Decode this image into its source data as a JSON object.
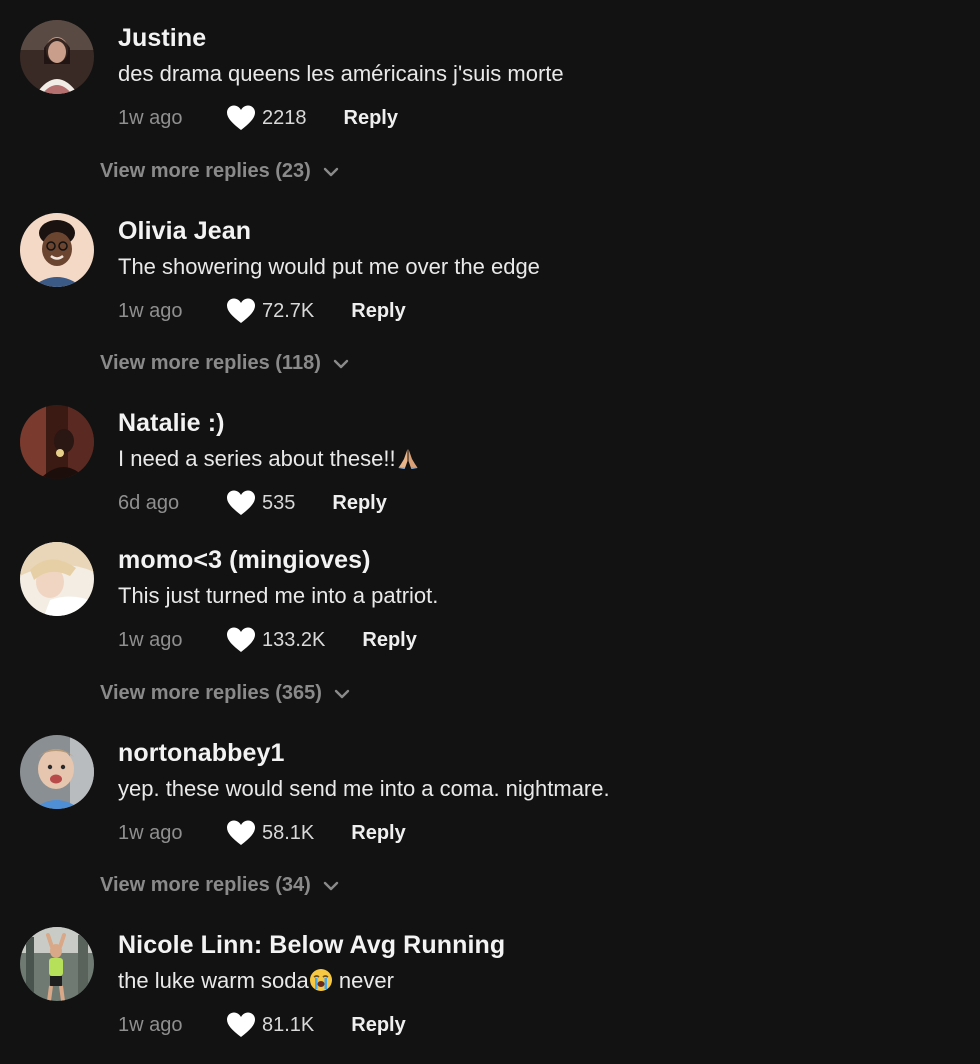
{
  "comments": [
    {
      "username": "Justine",
      "text": "des drama queens les américains j'suis morte",
      "time": "1w ago",
      "likes": "2218",
      "reply_label": "Reply",
      "view_more": "View more replies (23)",
      "avatar_icon": "avatar-photo",
      "avatar_colors": [
        "#3a2a26",
        "#c79a86"
      ]
    },
    {
      "username": "Olivia Jean",
      "text": "The showering would put me over the edge",
      "time": "1w ago",
      "likes": "72.7K",
      "reply_label": "Reply",
      "view_more": "View more replies (118)",
      "avatar_icon": "avatar-photo",
      "avatar_colors": [
        "#f4d9c6",
        "#6b4530"
      ]
    },
    {
      "username": "Natalie :)",
      "text": "I need a series about these!!",
      "text_emoji": "folded-hands-emoji",
      "time": "6d ago",
      "likes": "535",
      "reply_label": "Reply",
      "view_more": "",
      "avatar_icon": "avatar-photo",
      "avatar_colors": [
        "#3b1a14",
        "#7a3a2e"
      ]
    },
    {
      "username": "momo<3 (mingioves)",
      "text": "This just turned me into a patriot.",
      "time": "1w ago",
      "likes": "133.2K",
      "reply_label": "Reply",
      "view_more": "View more replies (365)",
      "avatar_icon": "avatar-photo",
      "avatar_colors": [
        "#e9d6b8",
        "#f3ede4"
      ]
    },
    {
      "username": "nortonabbey1",
      "text": "yep. these would send me into a coma. nightmare.",
      "time": "1w ago",
      "likes": "58.1K",
      "reply_label": "Reply",
      "view_more": "View more replies (34)",
      "avatar_icon": "avatar-photo",
      "avatar_colors": [
        "#8a8f93",
        "#e6c6ae"
      ]
    },
    {
      "username": "Nicole Linn: Below Avg Running",
      "text": "the luke warm soda",
      "text_emoji": "loudly-crying-face-emoji",
      "text_after": " never",
      "time": "1w ago",
      "likes": "81.1K",
      "reply_label": "Reply",
      "view_more": "",
      "avatar_icon": "avatar-photo",
      "avatar_colors": [
        "#6f7a72",
        "#b7e05a"
      ]
    }
  ],
  "colors": {
    "background": "#121212",
    "username": "#f3f3f3",
    "text": "#e9e9e9",
    "muted": "#8f8f8f",
    "view_more": "#8a8a8a"
  }
}
